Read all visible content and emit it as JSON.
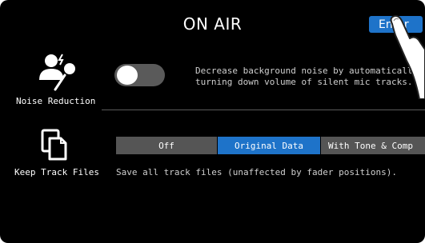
{
  "header": {
    "title": "ON AIR",
    "enter_label": "Enter"
  },
  "noise_reduction": {
    "label": "Noise Reduction",
    "toggle_state": "off",
    "description_line1": "Decrease background noise by automatically",
    "description_line2": "turning down volume of silent mic tracks."
  },
  "keep_track_files": {
    "label": "Keep Track Files",
    "options": [
      "Off",
      "Original Data",
      "With Tone & Comp"
    ],
    "selected": "Original Data",
    "description": "Save all track files (unaffected by fader positions)."
  },
  "colors": {
    "background": "#000000",
    "accent": "#1e73c9",
    "segment_inactive": "#555555",
    "toggle_off": "#5a5a5a"
  },
  "icons": {
    "noise_reduction": "microphone-icon",
    "keep_track_files": "files-icon",
    "pointer": "pointing-hand-icon"
  }
}
